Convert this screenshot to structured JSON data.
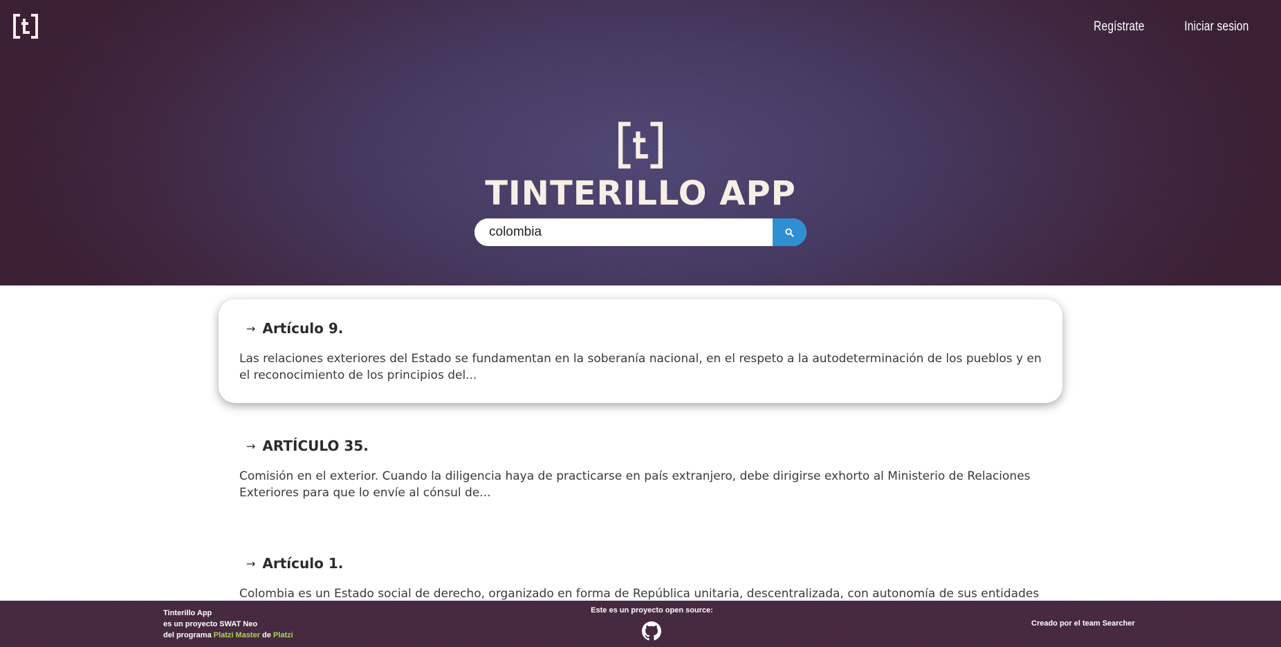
{
  "header": {
    "nav": {
      "register": "Regístrate",
      "login": "Iniciar sesion"
    }
  },
  "hero": {
    "title": "TINTERILLO APP",
    "search": {
      "value": "colombia",
      "placeholder": ""
    }
  },
  "results": [
    {
      "title": "Artículo 9.",
      "snippet": "Las relaciones exteriores del Estado se fundamentan en la soberanía nacional, en el respeto a la autodeterminación de los pueblos y en el reconocimiento de los principios del..."
    },
    {
      "title": "ARTÍCULO 35.",
      "snippet": "Comisión en el exterior. Cuando la diligencia haya de practicarse en país extranjero, debe dirigirse exhorto al Ministerio de Relaciones Exteriores para que lo envíe al cónsul de..."
    },
    {
      "title": "Artículo 1.",
      "snippet": "Colombia es un Estado social de derecho, organizado en forma de República unitaria, descentralizada, con autonomía de sus entidades"
    }
  ],
  "footer": {
    "left": {
      "line1": "Tinterillo App",
      "line2": "es un proyecto SWAT Neo",
      "line3_prefix": "del programa ",
      "link1": "Platzi Master",
      "line3_mid": " de ",
      "link2": "Platzi"
    },
    "center": "Este es un proyecto open source:",
    "right": "Creado por el team Searcher"
  },
  "colors": {
    "accent": "#2f8fd3",
    "footer_link": "#a6d84e",
    "title": "#f7eee6"
  }
}
